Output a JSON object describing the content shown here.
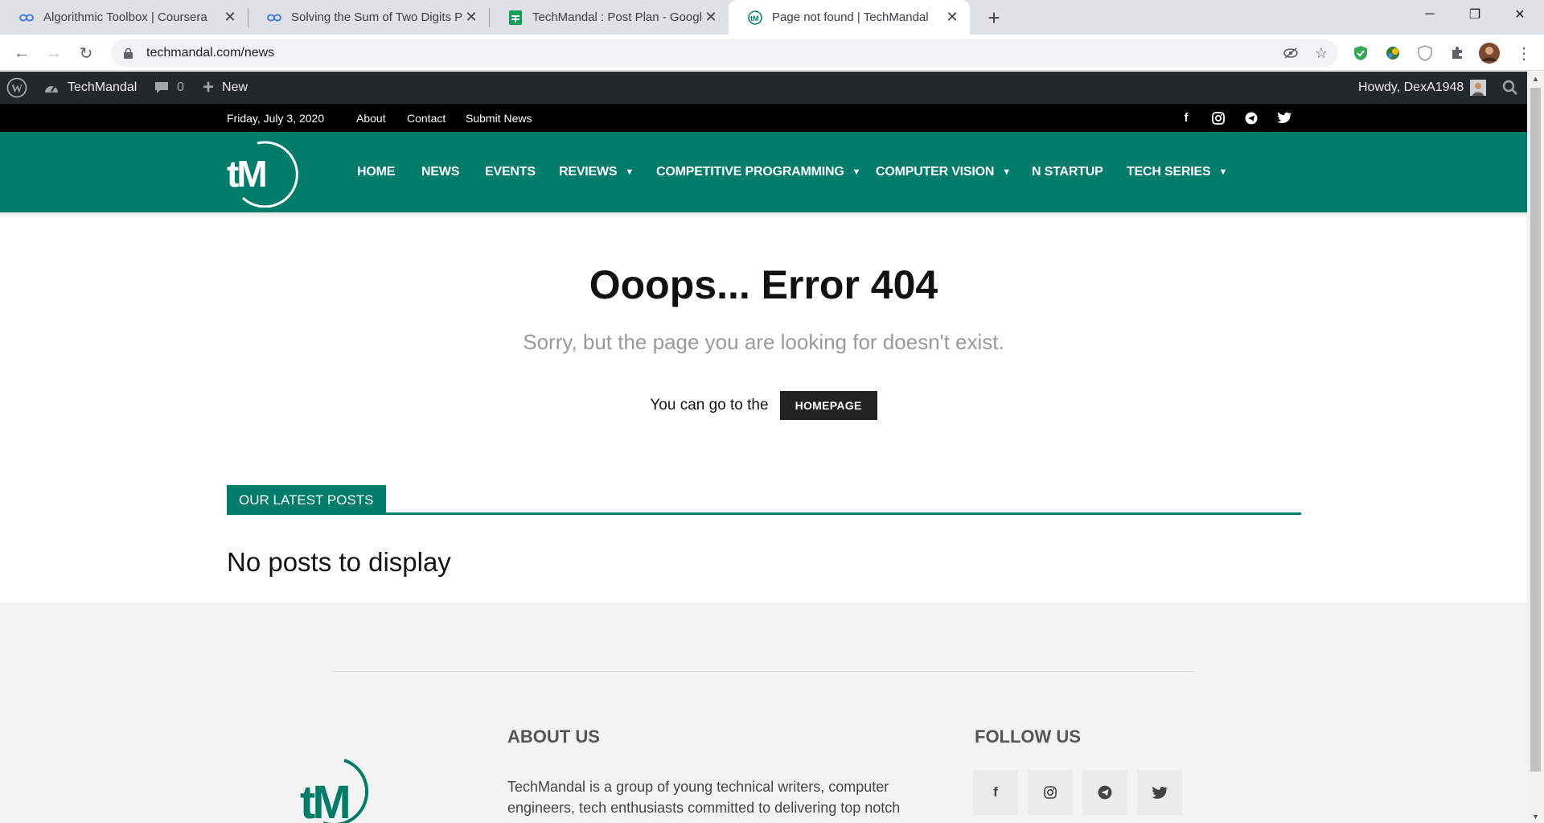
{
  "browser": {
    "tabs": [
      {
        "title": "Algorithmic Toolbox | Coursera",
        "icon": "coursera-icon"
      },
      {
        "title": "Solving the Sum of Two Digits Pr",
        "icon": "coursera-icon"
      },
      {
        "title": "TechMandal : Post Plan - Google",
        "icon": "sheets-icon"
      },
      {
        "title": "Page not found | TechMandal",
        "icon": "techmandal-icon",
        "active": true
      }
    ],
    "url": "techmandal.com/news"
  },
  "adminbar": {
    "site_name": "TechMandal",
    "comments_count": "0",
    "new_label": "New",
    "howdy": "Howdy, DexA1948"
  },
  "topbar": {
    "date": "Friday, July 3, 2020",
    "links": [
      "About",
      "Contact",
      "Submit News"
    ]
  },
  "nav": {
    "logo_text": "tM",
    "items": [
      {
        "label": "HOME"
      },
      {
        "label": "NEWS"
      },
      {
        "label": "EVENTS"
      },
      {
        "label": "REVIEWS",
        "dropdown": true
      },
      {
        "label": "COMPETITIVE PROGRAMMING",
        "dropdown": true
      },
      {
        "label": "COMPUTER VISION",
        "dropdown": true
      },
      {
        "label": "N STARTUP"
      },
      {
        "label": "TECH SERIES",
        "dropdown": true
      }
    ]
  },
  "error": {
    "title": "Ooops... Error 404",
    "subtitle": "Sorry, but the page you are looking for doesn't exist.",
    "goto_text": "You can go to the",
    "homepage_button": "HOMEPAGE"
  },
  "latest": {
    "heading": "OUR LATEST POSTS",
    "empty_text": "No posts to display"
  },
  "footer": {
    "about_heading": "ABOUT US",
    "about_text": "TechMandal is a group of young technical writers, computer engineers, tech enthusiasts committed to delivering top notch",
    "follow_heading": "FOLLOW US",
    "logo_text": "tM"
  },
  "colors": {
    "brand": "#007c6a",
    "adminbar": "#23282d",
    "topbar": "#000000"
  }
}
